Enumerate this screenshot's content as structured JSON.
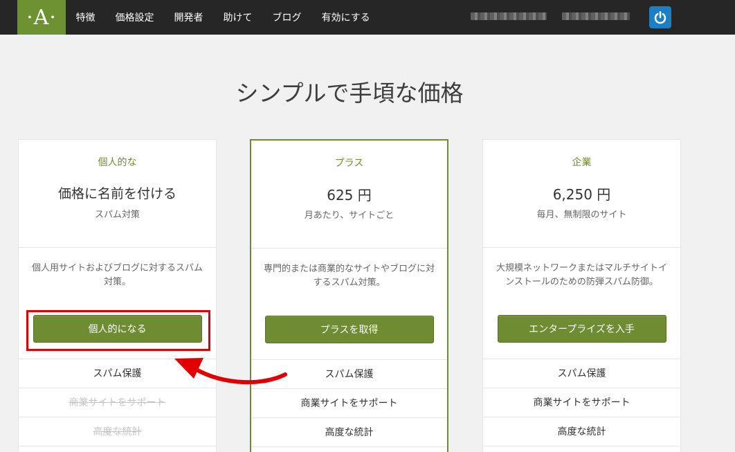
{
  "brand": {
    "logo": "·A·"
  },
  "nav": {
    "items": [
      "特徴",
      "価格設定",
      "開発者",
      "助けて",
      "ブログ",
      "有効にする"
    ]
  },
  "heading": "シンプルで手頃な価格",
  "colors": {
    "accent": "#6e8a34",
    "topbar": "#262626",
    "highlight": "#e00000",
    "power": "#1d7ec2"
  },
  "plans": [
    {
      "name": "個人的な",
      "price": "価格に名前を付ける",
      "sub": "スパム対策",
      "desc": "個人用サイトおよびブログに対するスパム対策。",
      "cta": "個人的になる",
      "features": [
        {
          "label": "スパム保護",
          "available": true
        },
        {
          "label": "商業サイトをサポート",
          "available": false
        },
        {
          "label": "高度な統計",
          "available": false
        }
      ]
    },
    {
      "name": "プラス",
      "price": "625 円",
      "sub": "月あたり、サイトごと",
      "desc": "専門的または商業的なサイトやブログに対するスパム対策。",
      "cta": "プラスを取得",
      "features": [
        {
          "label": "スパム保護",
          "available": true
        },
        {
          "label": "商業サイトをサポート",
          "available": true
        },
        {
          "label": "高度な統計",
          "available": true
        }
      ]
    },
    {
      "name": "企業",
      "price": "6,250 円",
      "sub": "毎月、無制限のサイト",
      "desc": "大規模ネットワークまたはマルチサイトインストールのための防弾スパム防御。",
      "cta": "エンタープライズを入手",
      "features": [
        {
          "label": "スパム保護",
          "available": true
        },
        {
          "label": "商業サイトをサポート",
          "available": true
        },
        {
          "label": "高度な統計",
          "available": true
        }
      ]
    }
  ]
}
